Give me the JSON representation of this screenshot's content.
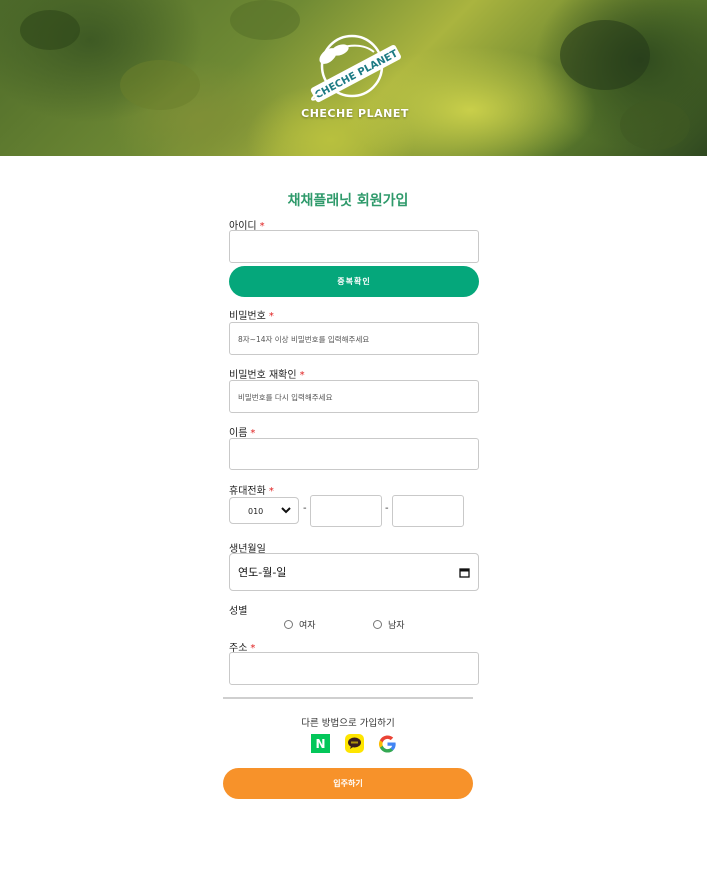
{
  "brand": {
    "logo_badge": "CHECHE PLANET",
    "name": "CHECHE PLANET"
  },
  "form": {
    "title": "채채플래닛 회원가입",
    "required_mark": "*",
    "id_label": "아이디",
    "id_value": "",
    "dup_check_button": "중복확인",
    "password_label": "비밀번호",
    "password_placeholder": "8자~14자 이상 비밀번호를 입력해주세요",
    "password_confirm_label": "비밀번호 재확인",
    "password_confirm_placeholder": "비밀번호를 다시 입력해주세요",
    "name_label": "이름",
    "name_value": "",
    "phone_label": "휴대전화",
    "phone_prefix_selected": "010",
    "phone_separator": "-",
    "phone_mid": "",
    "phone_last": "",
    "birth_label": "생년월일",
    "birth_placeholder": "연도-월-일",
    "gender_label": "성별",
    "gender_options": [
      "여자",
      "남자"
    ],
    "address_label": "주소",
    "address_value": "",
    "alt_signup_title": "다른 방법으로 가입하기",
    "sns": {
      "naver_letter": "N",
      "naver_color": "#03c75a",
      "kakao_icon": "kakao-talk-icon",
      "kakao_color": "#fee500",
      "google_icon": "google-icon"
    },
    "submit_button": "입주하기"
  },
  "colors": {
    "title": "#2f9a6b",
    "dup_button": "#05a77b",
    "submit_button": "#f7922a",
    "required": "#e02020"
  }
}
